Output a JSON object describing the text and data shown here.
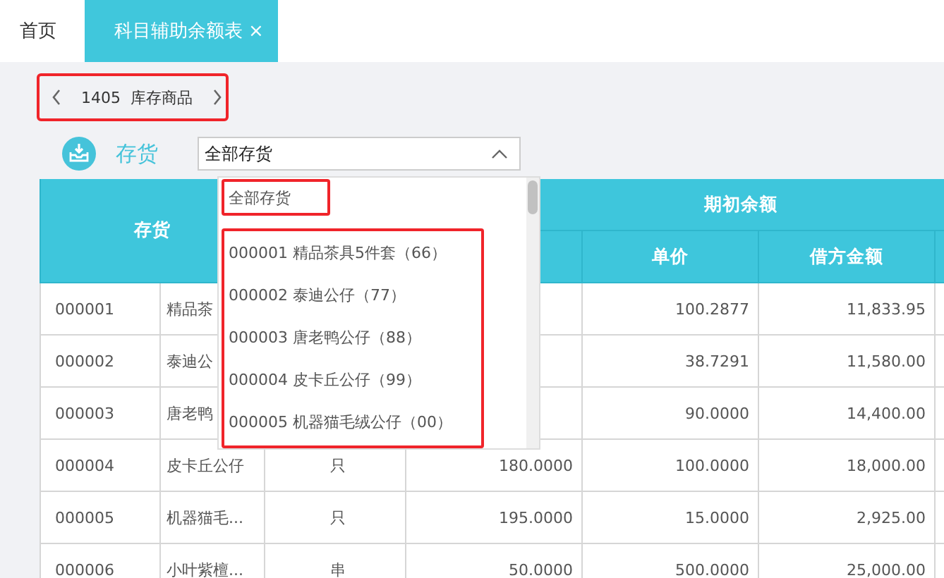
{
  "tabs": [
    {
      "label": "首页",
      "selected": false
    },
    {
      "label": "科目辅助余额表",
      "selected": true,
      "close": "×"
    }
  ],
  "account_nav": {
    "code": "1405",
    "name": "库存商品",
    "highlighted": true
  },
  "filter": {
    "label": "存货",
    "value": "全部存货",
    "expanded": true
  },
  "dropdown": {
    "all_option": {
      "label": "全部存货",
      "highlighted": true
    },
    "options_highlighted": true,
    "options": [
      "000001 精品茶具5件套（66）",
      "000002 泰迪公仔（77）",
      "000003 唐老鸭公仔（88）",
      "000004 皮卡丘公仔（99）",
      "000005 机器猫毛绒公仔（00）"
    ]
  },
  "table": {
    "first_heading": "存货",
    "group_heading": "期初余额",
    "columns": [
      "单价",
      "借方金额"
    ],
    "rows": [
      {
        "code": "000001",
        "name": "精品茶",
        "price": "100.2877",
        "debit": "11,833.95"
      },
      {
        "code": "000002",
        "name": "泰迪公",
        "price": "38.7291",
        "debit": "11,580.00"
      },
      {
        "code": "000003",
        "name": "唐老鸭",
        "price": "90.0000",
        "debit": "14,400.00"
      },
      {
        "code": "000004",
        "name": "皮卡丘公仔",
        "unit": "只",
        "quantity": "180.0000",
        "price": "100.0000",
        "debit": "18,000.00"
      },
      {
        "code": "000005",
        "name": "机器猫毛...",
        "unit": "只",
        "quantity": "195.0000",
        "price": "15.0000",
        "debit": "2,925.00"
      },
      {
        "code": "000006",
        "name": "小叶紫檀...",
        "unit": "串",
        "quantity": "50.0000",
        "price": "500.0000",
        "debit": "25,000.00"
      }
    ]
  }
}
